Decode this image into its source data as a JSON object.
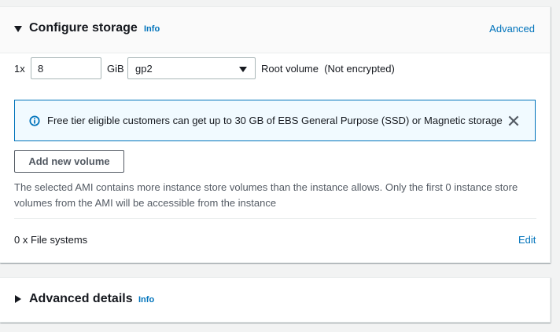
{
  "storage": {
    "title": "Configure storage",
    "info_label": "Info",
    "advanced_link": "Advanced",
    "volume": {
      "count_prefix": "1x",
      "size_value": "8",
      "size_unit": "GiB",
      "volume_type": "gp2",
      "description": "Root volume  (Not encrypted)"
    },
    "alert": {
      "icon": "info-circle-icon",
      "text": "Free tier eligible customers can get up to 30 GB of EBS General Purpose (SSD) or Magnetic storage",
      "close_icon": "close-icon"
    },
    "add_volume_label": "Add new volume",
    "note": "The selected AMI contains more instance store volumes than the instance allows. Only the first 0 instance store volumes from the AMI will be accessible from the instance",
    "file_systems_label": "0 x File systems",
    "edit_label": "Edit"
  },
  "advanced_details": {
    "title": "Advanced details",
    "info_label": "Info"
  },
  "colors": {
    "link": "#0073bb",
    "alert_bg": "#f1faff",
    "alert_border": "#0073bb",
    "text": "#16191f",
    "muted_text": "#545b64"
  }
}
